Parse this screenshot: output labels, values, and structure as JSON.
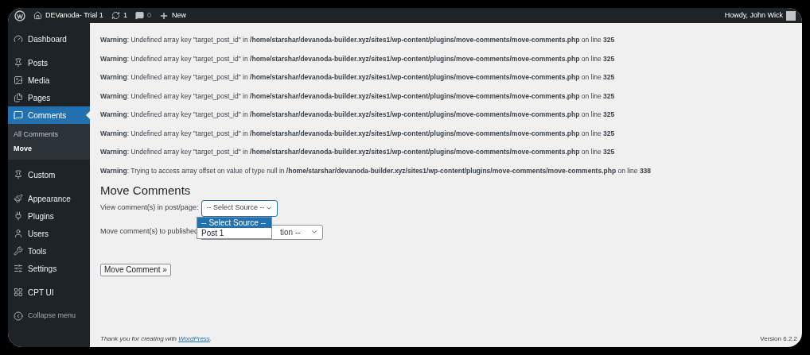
{
  "admin_bar": {
    "site": "DEVanoda- Trial 1",
    "updates": "1",
    "comments": "0",
    "new": "New",
    "greeting": "Howdy, John Wick"
  },
  "sidebar": {
    "items": [
      {
        "label": "Dashboard",
        "selected": false
      },
      {
        "label": "Posts",
        "selected": false
      },
      {
        "label": "Media",
        "selected": false
      },
      {
        "label": "Pages",
        "selected": false
      },
      {
        "label": "Comments",
        "selected": true,
        "children": [
          {
            "label": "All Comments",
            "selected": false
          },
          {
            "label": "Move",
            "selected": true
          }
        ]
      },
      {
        "label": "Custom",
        "selected": false
      },
      {
        "label": "Appearance",
        "selected": false
      },
      {
        "label": "Plugins",
        "selected": false
      },
      {
        "label": "Users",
        "selected": false
      },
      {
        "label": "Tools",
        "selected": false
      },
      {
        "label": "Settings",
        "selected": false
      },
      {
        "label": "CPT UI",
        "selected": false
      }
    ],
    "collapse": "Collapse menu"
  },
  "warnings": [
    "**Warning**: Undefined array key \"target_post_id\" in **/home/starshar/devanoda-builder.xyz/sites1/wp-content/plugins/move-comments/move-comments.php** on line **325**",
    "**Warning**: Undefined array key \"target_post_id\" in **/home/starshar/devanoda-builder.xyz/sites1/wp-content/plugins/move-comments/move-comments.php** on line **325**",
    "**Warning**: Undefined array key \"target_post_id\" in **/home/starshar/devanoda-builder.xyz/sites1/wp-content/plugins/move-comments/move-comments.php** on line **325**",
    "**Warning**: Undefined array key \"target_post_id\" in **/home/starshar/devanoda-builder.xyz/sites1/wp-content/plugins/move-comments/move-comments.php** on line **325**",
    "**Warning**: Undefined array key \"target_post_id\" in **/home/starshar/devanoda-builder.xyz/sites1/wp-content/plugins/move-comments/move-comments.php** on line **325**",
    "**Warning**: Undefined array key \"target_post_id\" in **/home/starshar/devanoda-builder.xyz/sites1/wp-content/plugins/move-comments/move-comments.php** on line **325**",
    "**Warning**: Undefined array key \"target_post_id\" in **/home/starshar/devanoda-builder.xyz/sites1/wp-content/plugins/move-comments/move-comments.php** on line **325**",
    "**Warning**: Trying to access array offset on value of type null in **/home/starshar/devanoda-builder.xyz/sites1/wp-content/plugins/move-comments/move-comments.php** on line **338**"
  ],
  "form": {
    "title": "Move Comments",
    "source": {
      "label": "View comment(s) in post/page:",
      "value": "-- Select Source --",
      "expanded": true,
      "options": [
        {
          "label": "-- Select Source --",
          "selected": true
        },
        {
          "label": "Post 1",
          "selected": false
        }
      ]
    },
    "destination": {
      "label": "Move comment(s) to published",
      "value": "tion --"
    },
    "button": "Move Comment »"
  },
  "footer": {
    "text": "Thank you for creating with",
    "link": "WordPress",
    "end": ".",
    "version": "Version 6.2.2"
  }
}
